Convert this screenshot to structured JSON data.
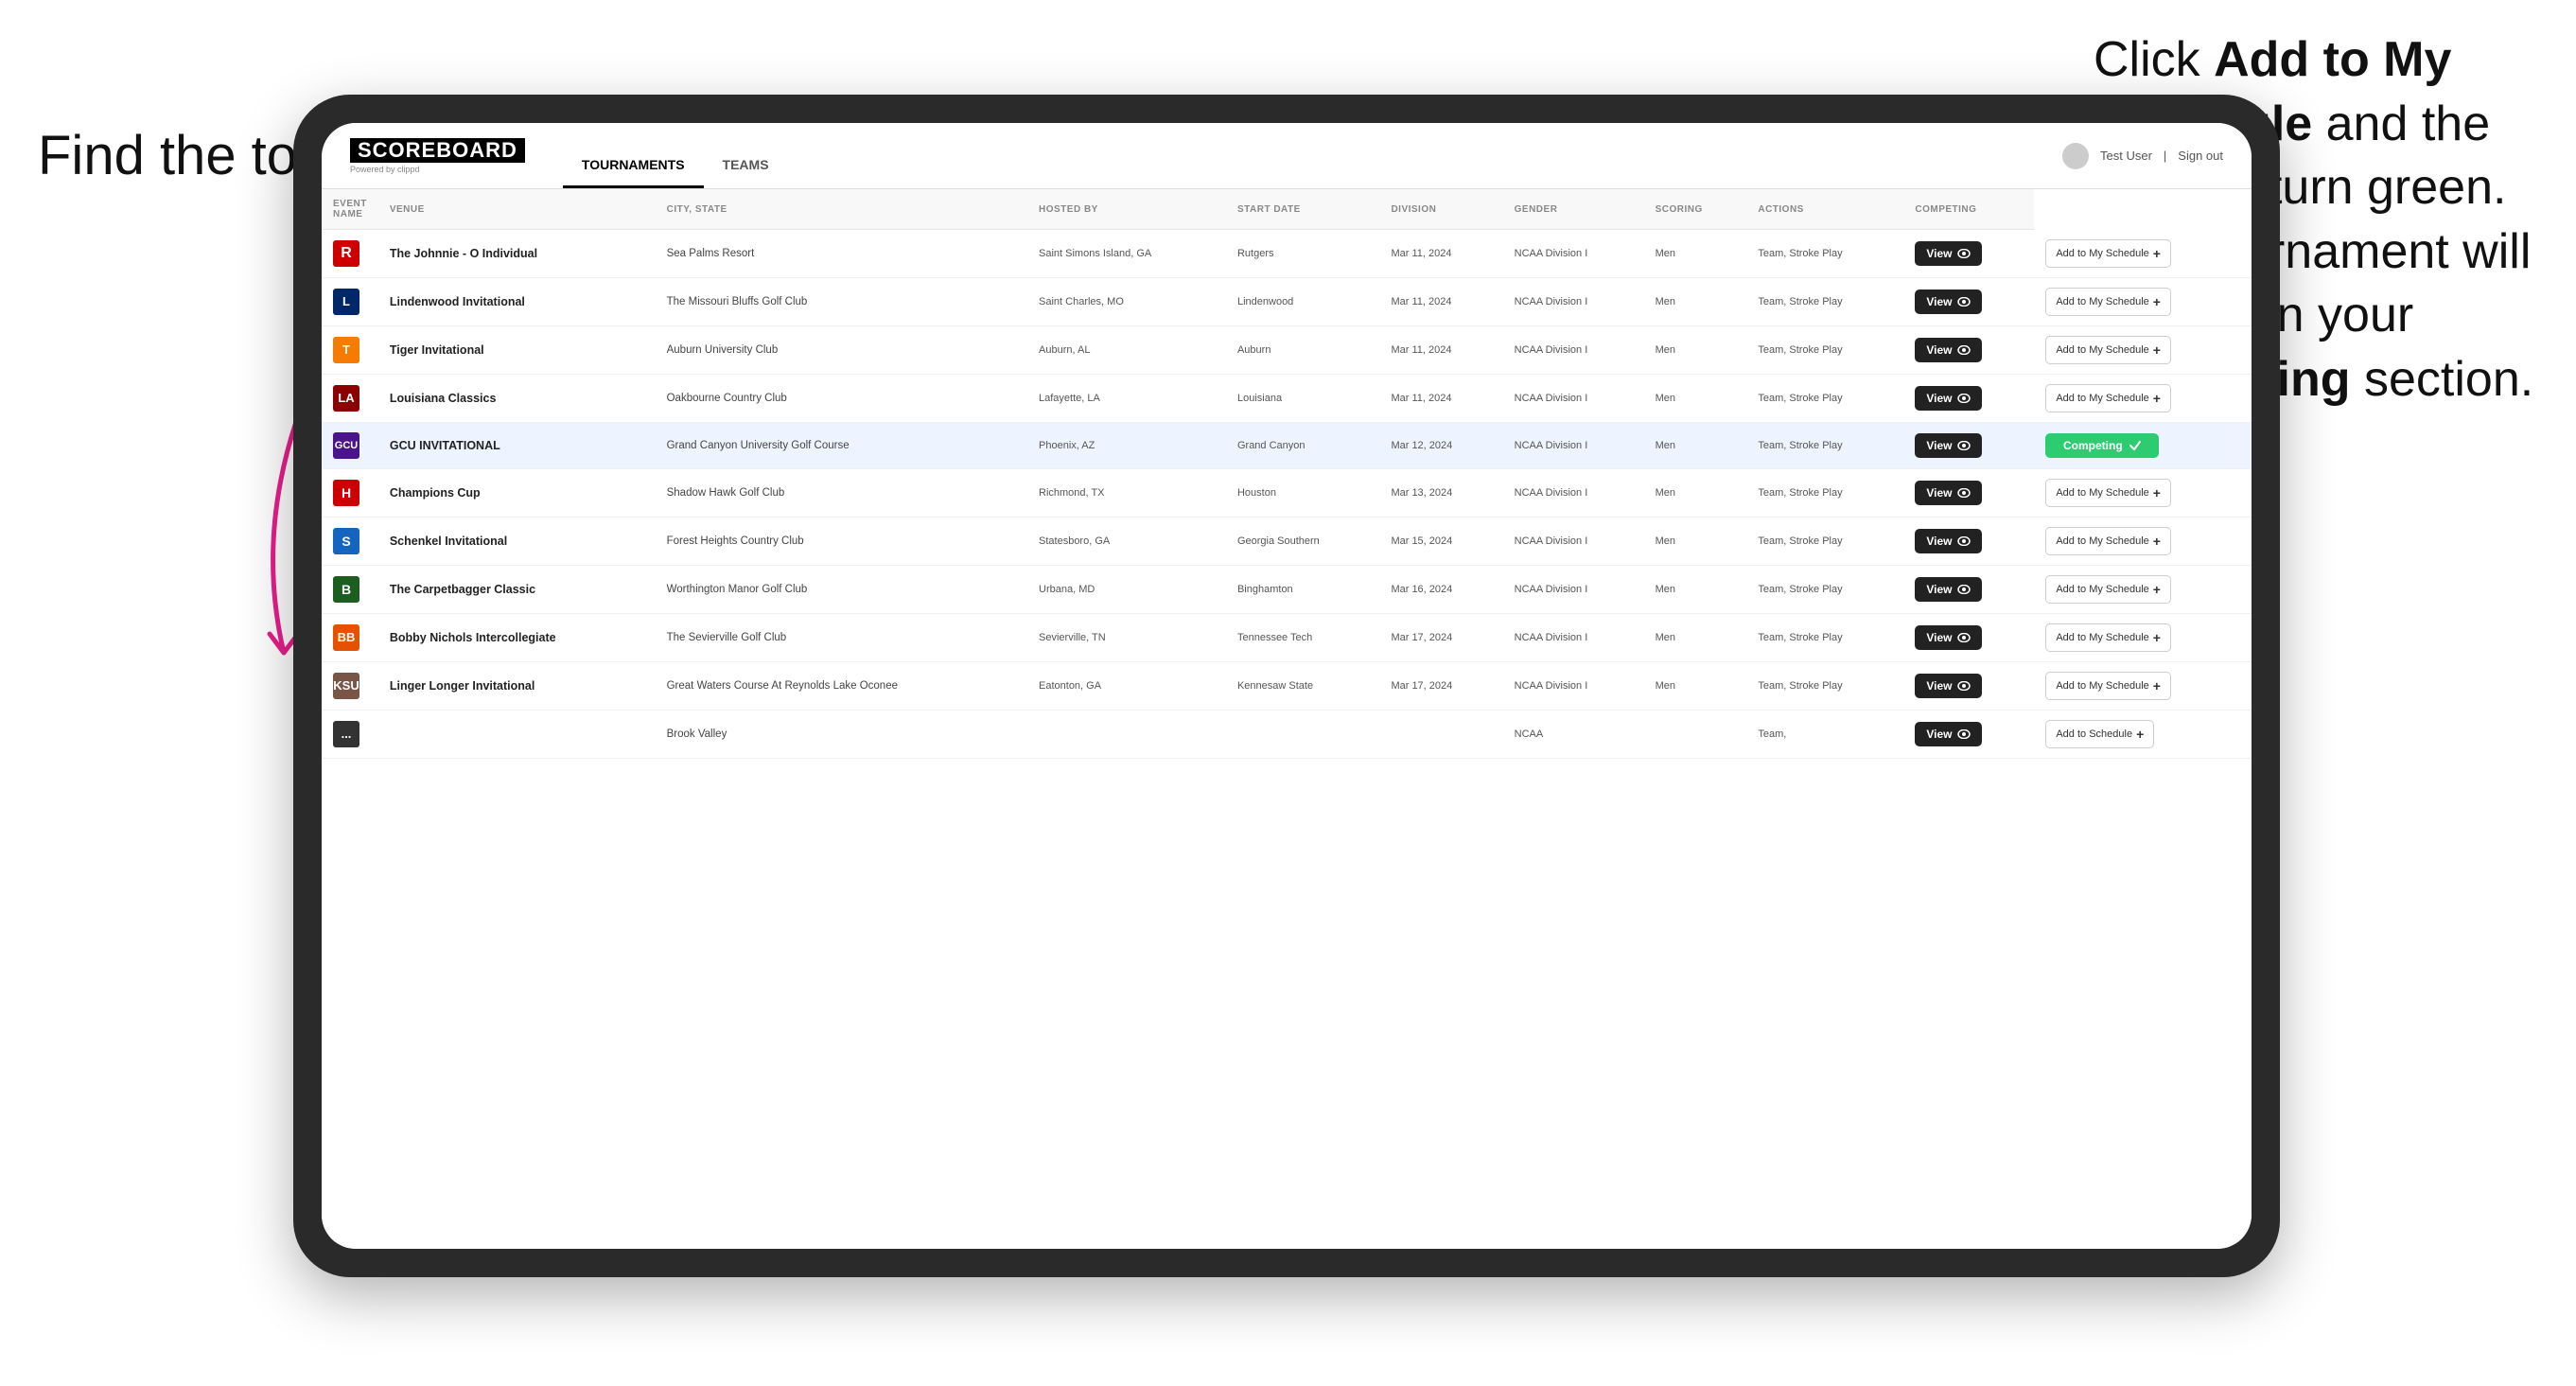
{
  "annotations": {
    "left_title": "Find the tournament.",
    "right_title": "Click ",
    "right_bold1": "Add to My Schedule",
    "right_mid": " and the box will turn green. This tournament will now be in your ",
    "right_bold2": "Competing",
    "right_end": " section."
  },
  "navbar": {
    "logo": "SCOREBOARD",
    "logo_sub": "Powered by clippd",
    "tabs": [
      "TOURNAMENTS",
      "TEAMS"
    ],
    "active_tab": "TOURNAMENTS",
    "user": "Test User",
    "signout": "Sign out"
  },
  "table": {
    "columns": [
      "EVENT NAME",
      "VENUE",
      "CITY, STATE",
      "HOSTED BY",
      "START DATE",
      "DIVISION",
      "GENDER",
      "SCORING",
      "ACTIONS",
      "COMPETING"
    ],
    "rows": [
      {
        "logo": "R",
        "logo_class": "logo-r",
        "name": "The Johnnie - O Individual",
        "venue": "Sea Palms Resort",
        "city": "Saint Simons Island, GA",
        "hosted": "Rutgers",
        "date": "Mar 11, 2024",
        "division": "NCAA Division I",
        "gender": "Men",
        "scoring": "Team, Stroke Play",
        "action": "View",
        "competing": "Add to My Schedule",
        "competing_type": "add",
        "highlighted": false
      },
      {
        "logo": "L",
        "logo_class": "logo-l",
        "name": "Lindenwood Invitational",
        "venue": "The Missouri Bluffs Golf Club",
        "city": "Saint Charles, MO",
        "hosted": "Lindenwood",
        "date": "Mar 11, 2024",
        "division": "NCAA Division I",
        "gender": "Men",
        "scoring": "Team, Stroke Play",
        "action": "View",
        "competing": "Add to My Schedule",
        "competing_type": "add",
        "highlighted": false
      },
      {
        "logo": "T",
        "logo_class": "logo-tiger",
        "name": "Tiger Invitational",
        "venue": "Auburn University Club",
        "city": "Auburn, AL",
        "hosted": "Auburn",
        "date": "Mar 11, 2024",
        "division": "NCAA Division I",
        "gender": "Men",
        "scoring": "Team, Stroke Play",
        "action": "View",
        "competing": "Add to My Schedule",
        "competing_type": "add",
        "highlighted": false
      },
      {
        "logo": "LA",
        "logo_class": "logo-la",
        "name": "Louisiana Classics",
        "venue": "Oakbourne Country Club",
        "city": "Lafayette, LA",
        "hosted": "Louisiana",
        "date": "Mar 11, 2024",
        "division": "NCAA Division I",
        "gender": "Men",
        "scoring": "Team, Stroke Play",
        "action": "View",
        "competing": "Add to My Schedule",
        "competing_type": "add",
        "highlighted": false
      },
      {
        "logo": "GCU",
        "logo_class": "logo-gcu",
        "name": "GCU INVITATIONAL",
        "venue": "Grand Canyon University Golf Course",
        "city": "Phoenix, AZ",
        "hosted": "Grand Canyon",
        "date": "Mar 12, 2024",
        "division": "NCAA Division I",
        "gender": "Men",
        "scoring": "Team, Stroke Play",
        "action": "View",
        "competing": "Competing",
        "competing_type": "competing",
        "highlighted": true
      },
      {
        "logo": "H",
        "logo_class": "logo-h",
        "name": "Champions Cup",
        "venue": "Shadow Hawk Golf Club",
        "city": "Richmond, TX",
        "hosted": "Houston",
        "date": "Mar 13, 2024",
        "division": "NCAA Division I",
        "gender": "Men",
        "scoring": "Team, Stroke Play",
        "action": "View",
        "competing": "Add to My Schedule",
        "competing_type": "add",
        "highlighted": false
      },
      {
        "logo": "S",
        "logo_class": "logo-s",
        "name": "Schenkel Invitational",
        "venue": "Forest Heights Country Club",
        "city": "Statesboro, GA",
        "hosted": "Georgia Southern",
        "date": "Mar 15, 2024",
        "division": "NCAA Division I",
        "gender": "Men",
        "scoring": "Team, Stroke Play",
        "action": "View",
        "competing": "Add to My Schedule",
        "competing_type": "add",
        "highlighted": false
      },
      {
        "logo": "B",
        "logo_class": "logo-b",
        "name": "The Carpetbagger Classic",
        "venue": "Worthington Manor Golf Club",
        "city": "Urbana, MD",
        "hosted": "Binghamton",
        "date": "Mar 16, 2024",
        "division": "NCAA Division I",
        "gender": "Men",
        "scoring": "Team, Stroke Play",
        "action": "View",
        "competing": "Add to My Schedule",
        "competing_type": "add",
        "highlighted": false
      },
      {
        "logo": "BB",
        "logo_class": "logo-bb",
        "name": "Bobby Nichols Intercollegiate",
        "venue": "The Sevierville Golf Club",
        "city": "Sevierville, TN",
        "hosted": "Tennessee Tech",
        "date": "Mar 17, 2024",
        "division": "NCAA Division I",
        "gender": "Men",
        "scoring": "Team, Stroke Play",
        "action": "View",
        "competing": "Add to My Schedule",
        "competing_type": "add",
        "highlighted": false
      },
      {
        "logo": "KSU",
        "logo_class": "logo-ksu",
        "name": "Linger Longer Invitational",
        "venue": "Great Waters Course At Reynolds Lake Oconee",
        "city": "Eatonton, GA",
        "hosted": "Kennesaw State",
        "date": "Mar 17, 2024",
        "division": "NCAA Division I",
        "gender": "Men",
        "scoring": "Team, Stroke Play",
        "action": "View",
        "competing": "Add to My Schedule",
        "competing_type": "add",
        "highlighted": false
      },
      {
        "logo": "...",
        "logo_class": "logo-last",
        "name": "",
        "venue": "Brook Valley",
        "city": "",
        "hosted": "",
        "date": "",
        "division": "NCAA",
        "gender": "",
        "scoring": "Team,",
        "action": "View",
        "competing": "Add to Schedule",
        "competing_type": "add",
        "highlighted": false
      }
    ]
  }
}
